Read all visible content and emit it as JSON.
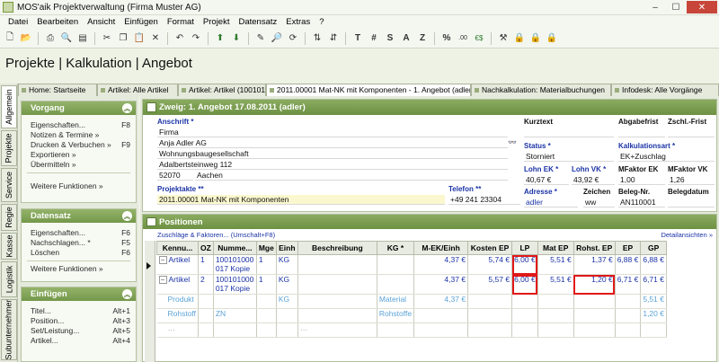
{
  "window": {
    "title": "MOS'aik Projektverwaltung (Firma Muster AG)",
    "min": "–",
    "max": "☐",
    "close": "✕"
  },
  "menu": [
    "Datei",
    "Bearbeiten",
    "Ansicht",
    "Einfügen",
    "Format",
    "Projekt",
    "Datensatz",
    "Extras",
    "?"
  ],
  "toolbar": {
    "text_buttons": [
      "T",
      "#",
      "S",
      "A",
      "Z",
      "%",
      "€$"
    ]
  },
  "page_title": "Projekte | Kalkulation | Angebot",
  "vertical_tabs": [
    "Allgemein",
    "Projekte",
    "Service",
    "Regie",
    "Kasse",
    "Logistik",
    "Subunternehmer"
  ],
  "tabs": [
    "Home: Startseite",
    "Artikel: Alle Artikel",
    "Artikel: Artikel (100101000",
    "2011.00001 Mat-NK mit Komponenten - 1. Angebot (adler)",
    "Nachkalkulation: Materialbuchungen",
    "Infodesk: Alle Vorgänge"
  ],
  "sidebar": {
    "vorgang": {
      "title": "Vorgang",
      "items": [
        {
          "label": "Eigenschaften...",
          "key": "F8"
        },
        {
          "label": "Notizen & Termine »",
          "key": ""
        },
        {
          "label": "Drucken & Verbuchen »",
          "key": "F9"
        },
        {
          "label": "Exportieren »",
          "key": ""
        },
        {
          "label": "Übermitteln »",
          "key": ""
        }
      ],
      "more": "Weitere Funktionen »"
    },
    "datensatz": {
      "title": "Datensatz",
      "items": [
        {
          "label": "Eigenschaften...",
          "key": "F6"
        },
        {
          "label": "Nachschlagen... *",
          "key": "F5"
        },
        {
          "label": "Löschen",
          "key": "F6"
        }
      ],
      "more": "Weitere Funktionen »"
    },
    "einfuegen": {
      "title": "Einfügen",
      "items": [
        {
          "label": "Titel...",
          "key": "Alt+1"
        },
        {
          "label": "Position...",
          "key": "Alt+3"
        },
        {
          "label": "Set/Leistung...",
          "key": "Alt+5"
        },
        {
          "label": "Artikel...",
          "key": "Alt+4"
        }
      ]
    }
  },
  "zweig": {
    "title": "Zweig: 1. Angebot 17.08.2011 (adler)",
    "anschrift_label": "Anschrift *",
    "anschrift": [
      "Firma",
      "Anja Adler AG",
      "Wohnungsbaugesellschaft",
      "Adalbertsteinweg 112"
    ],
    "plz": "52070",
    "ort": "Aachen",
    "kurztext_label": "Kurztext",
    "kurztext": "",
    "abgabefrist_label": "Abgabefrist",
    "zschl_frist_label": "Zschl.-Frist",
    "status_label": "Status *",
    "status": "Storniert",
    "kalkulationsart_label": "Kalkulationsart *",
    "kalkulationsart": "EK+Zuschlag",
    "lohn_ek_label": "Lohn EK *",
    "lohn_ek": "40,67 €",
    "lohn_vk_label": "Lohn VK *",
    "lohn_vk": "43,92 €",
    "mfaktor_ek_label": "MFaktor EK",
    "mfaktor_ek": "1,00",
    "mfaktor_vk_label": "MFaktor VK",
    "mfaktor_vk": "1,26",
    "projektakte_label": "Projektakte **",
    "projektakte": "2011.00001 Mat-NK mit Komponenten",
    "telefon_label": "Telefon **",
    "telefon": "+49 241 23304",
    "adresse_label": "Adresse *",
    "adresse": "adler",
    "zeichen_label": "Zeichen",
    "zeichen": "ww",
    "belegnr_label": "Beleg-Nr.",
    "belegnr": "AN110001",
    "belegdatum_label": "Belegdatum"
  },
  "positionen": {
    "title": "Positionen",
    "link_left": "Zuschläge & Faktoren... (Umschalt+F8)",
    "link_right": "Detailansichten »",
    "columns": [
      "Kennu...",
      "OZ",
      "Numme...",
      "Mge",
      "Einh",
      "Beschreibung",
      "KG *",
      "M-EK/Einh",
      "Kosten EP",
      "LP",
      "Mat EP",
      "Rohst. EP",
      "EP",
      "GP"
    ],
    "rows": [
      [
        "Artikel",
        "1",
        "100101000\n017 Kopie",
        "1",
        "KG",
        "",
        "",
        "4,37 €",
        "5,74 €",
        "6,00 €",
        "5,51 €",
        "1,37 €",
        "6,88 €",
        "6,88 €"
      ],
      [
        "Artikel",
        "2",
        "100101000\n017 Kopie",
        "1",
        "KG",
        "",
        "",
        "4,37 €",
        "5,57 €",
        "6,00 €",
        "5,51 €",
        "1,20 €",
        "6,71 €",
        "6,71 €"
      ],
      [
        "Produkt",
        "",
        "",
        "",
        "KG",
        "",
        "Material",
        "4,37 €",
        "",
        "",
        "",
        "",
        "",
        "5,51 €"
      ],
      [
        "Rohstoff",
        "",
        "ZN",
        "",
        "",
        "",
        "Rohstoffe",
        "",
        "",
        "",
        "",
        "",
        "",
        "1,20 €"
      ]
    ]
  }
}
